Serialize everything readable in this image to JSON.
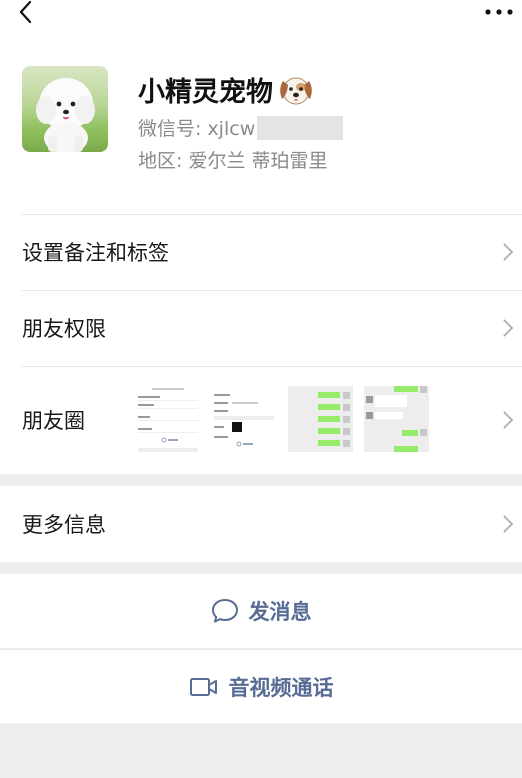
{
  "profile": {
    "nickname": "小精灵宠物",
    "wechat_id": "微信号: xjlcw",
    "region": "地区: 爱尔兰  蒂珀雷里"
  },
  "rows": {
    "remarks": "设置备注和标签",
    "permissions": "朋友权限",
    "moments": "朋友圈",
    "more_info": "更多信息"
  },
  "actions": {
    "message": "发消息",
    "call": "音视频通话"
  },
  "colors": {
    "action_link": "#576b95",
    "background": "#ededed",
    "bubble_green": "#95ec69"
  },
  "icons": [
    "back-arrow",
    "more-dots",
    "chevron-right",
    "chat-bubble",
    "video-camera",
    "dog-face-emoji"
  ]
}
